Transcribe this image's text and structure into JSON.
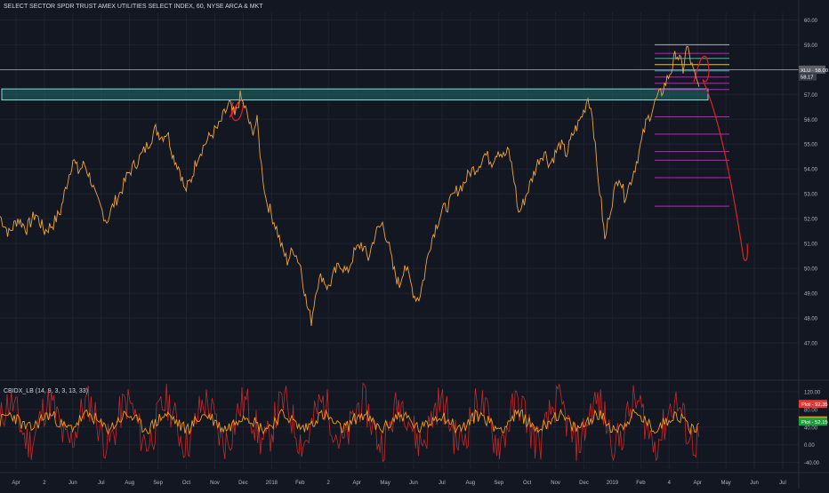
{
  "header": {
    "title": "SELECT SECTOR SPDR TRUST AMEX UTILITIES SELECT INDEX, 60, NYSE ARCA & MKT"
  },
  "indicator": {
    "title": "CBIDX_LB (14, 9, 3, 3, 13, 33)",
    "labels": [
      "Plot - 92.35",
      "Plot - 55.04",
      "Plot - 52.15"
    ],
    "label_colors": [
      "#e53935",
      "#ff9800",
      "#1b9e3e"
    ],
    "y_ticks": [
      "120.00",
      "80.00",
      "40.00",
      "0.00",
      "-40.00"
    ]
  },
  "price_badges": {
    "current": "XLU · 58.00",
    "secondary": "58.17"
  },
  "colors": {
    "background": "#131722",
    "price_line": "#f0a33a",
    "zone_fill": "#1f6e6a",
    "zone_stroke": "#7ee0d8",
    "fib_magenta": "#c020c0",
    "annotation": "#e02020",
    "grid": "#1e2230",
    "osc_red": "#c62828",
    "osc_orange": "#f39c12"
  },
  "chart_data": [
    {
      "type": "line",
      "name": "price",
      "y_ticks": [
        "60.00",
        "59.00",
        "58.00",
        "57.00",
        "56.00",
        "55.00",
        "54.00",
        "53.00",
        "52.00",
        "51.00",
        "50.00",
        "49.00",
        "48.00",
        "47.00"
      ],
      "ylim": [
        46.5,
        60.3
      ],
      "x_labels": [
        "Apr",
        "2",
        "Jun",
        "Jul",
        "Aug",
        "Sep",
        "Oct",
        "Nov",
        "Dec",
        "2018",
        "Feb",
        "2",
        "Apr",
        "May",
        "Jun",
        "Jul",
        "Aug",
        "Sep",
        "Oct",
        "Nov",
        "Dec",
        "2019",
        "Feb",
        "4",
        "Apr",
        "May",
        "Jun",
        "Jul"
      ],
      "points": [
        [
          0,
          52.1
        ],
        [
          10,
          51.4
        ],
        [
          20,
          52.0
        ],
        [
          30,
          51.6
        ],
        [
          40,
          52.2
        ],
        [
          50,
          51.5
        ],
        [
          60,
          51.8
        ],
        [
          68,
          52.3
        ],
        [
          75,
          53.4
        ],
        [
          82,
          54.4
        ],
        [
          88,
          53.9
        ],
        [
          95,
          54.2
        ],
        [
          102,
          53.6
        ],
        [
          108,
          52.8
        ],
        [
          115,
          52.3
        ],
        [
          120,
          51.9
        ],
        [
          128,
          52.6
        ],
        [
          136,
          53.1
        ],
        [
          144,
          53.8
        ],
        [
          152,
          54.2
        ],
        [
          160,
          54.6
        ],
        [
          168,
          55.1
        ],
        [
          175,
          55.6
        ],
        [
          182,
          55.3
        ],
        [
          188,
          55.5
        ],
        [
          195,
          54.5
        ],
        [
          202,
          54.0
        ],
        [
          208,
          53.1
        ],
        [
          215,
          53.6
        ],
        [
          222,
          54.5
        ],
        [
          230,
          55.0
        ],
        [
          238,
          55.4
        ],
        [
          246,
          55.7
        ],
        [
          252,
          56.2
        ],
        [
          258,
          56.6
        ],
        [
          264,
          56.1
        ],
        [
          270,
          56.9
        ],
        [
          276,
          56.4
        ],
        [
          283,
          55.5
        ],
        [
          289,
          55.9
        ],
        [
          294,
          54.1
        ],
        [
          299,
          52.8
        ],
        [
          305,
          52.2
        ],
        [
          311,
          51.6
        ],
        [
          317,
          50.8
        ],
        [
          323,
          50.3
        ],
        [
          330,
          50.8
        ],
        [
          338,
          50.1
        ],
        [
          345,
          48.5
        ],
        [
          350,
          47.9
        ],
        [
          356,
          49.3
        ],
        [
          362,
          49.7
        ],
        [
          369,
          49.2
        ],
        [
          376,
          49.8
        ],
        [
          383,
          50.2
        ],
        [
          390,
          49.8
        ],
        [
          398,
          50.6
        ],
        [
          406,
          51.0
        ],
        [
          414,
          50.4
        ],
        [
          422,
          51.4
        ],
        [
          430,
          51.8
        ],
        [
          436,
          51.1
        ],
        [
          442,
          50.0
        ],
        [
          449,
          49.3
        ],
        [
          455,
          50.2
        ],
        [
          460,
          49.6
        ],
        [
          466,
          48.9
        ],
        [
          471,
          48.8
        ],
        [
          477,
          49.7
        ],
        [
          483,
          50.9
        ],
        [
          490,
          51.7
        ],
        [
          497,
          52.3
        ],
        [
          505,
          52.6
        ],
        [
          513,
          53.1
        ],
        [
          521,
          53.4
        ],
        [
          529,
          53.9
        ],
        [
          537,
          54.1
        ],
        [
          545,
          54.6
        ],
        [
          553,
          54.3
        ],
        [
          560,
          54.8
        ],
        [
          566,
          54.5
        ],
        [
          572,
          54.7
        ],
        [
          578,
          53.6
        ],
        [
          583,
          52.2
        ],
        [
          588,
          52.6
        ],
        [
          594,
          53.2
        ],
        [
          600,
          53.8
        ],
        [
          606,
          54.4
        ],
        [
          612,
          54.7
        ],
        [
          618,
          54.2
        ],
        [
          624,
          54.6
        ],
        [
          630,
          55.0
        ],
        [
          637,
          54.6
        ],
        [
          644,
          55.4
        ],
        [
          650,
          55.8
        ],
        [
          656,
          56.3
        ],
        [
          661,
          56.9
        ],
        [
          666,
          56.2
        ],
        [
          671,
          54.1
        ],
        [
          676,
          52.6
        ],
        [
          680,
          51.1
        ],
        [
          685,
          52.2
        ],
        [
          690,
          53.0
        ],
        [
          696,
          53.8
        ],
        [
          702,
          52.9
        ],
        [
          708,
          53.4
        ],
        [
          714,
          54.1
        ],
        [
          720,
          54.9
        ],
        [
          726,
          55.8
        ],
        [
          732,
          56.3
        ],
        [
          738,
          56.8
        ],
        [
          744,
          57.1
        ],
        [
          750,
          57.6
        ],
        [
          756,
          58.1
        ],
        [
          760,
          58.7
        ],
        [
          764,
          58.4
        ],
        [
          768,
          58.0
        ],
        [
          772,
          58.9
        ],
        [
          775,
          58.6
        ],
        [
          778,
          58.1
        ],
        [
          782,
          57.6
        ],
        [
          786,
          57.3
        ]
      ]
    },
    {
      "type": "line",
      "name": "oscillator",
      "ylim": [
        -55,
        130
      ],
      "y_ticks": [
        "120.00",
        "80.00",
        "40.00",
        "0.00",
        "-40.00"
      ],
      "levels": [
        92.35,
        55.04,
        52.15
      ],
      "description_series": [
        "red",
        "orange"
      ]
    }
  ],
  "annotations": {
    "zone": {
      "y_low": 56.85,
      "y_high": 57.15
    },
    "fib_levels_upper": [
      59.0,
      58.65,
      58.45,
      58.2,
      57.95,
      57.7,
      57.45,
      57.2
    ],
    "fib_levels_lower": [
      56.1,
      55.4,
      54.7,
      54.35,
      53.65,
      52.5
    ],
    "horizontal_line": 58.0
  }
}
